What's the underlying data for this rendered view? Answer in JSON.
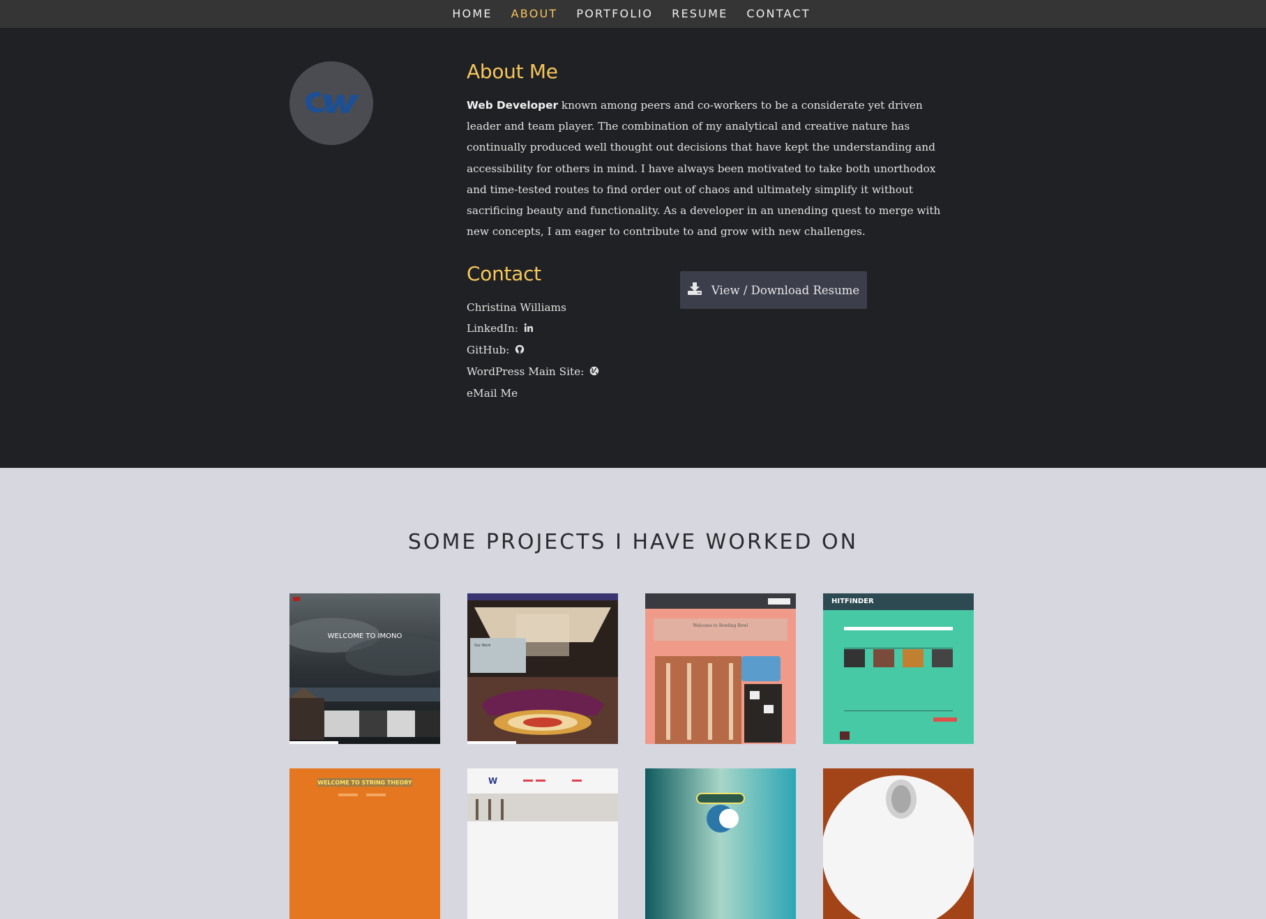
{
  "nav": {
    "items": [
      "HOME",
      "ABOUT",
      "PORTFOLIO",
      "RESUME",
      "CONTACT"
    ],
    "active": "ABOUT"
  },
  "about": {
    "heading": "About Me",
    "role": "Web Developer",
    "bio": " known among peers and co-workers to be a considerate yet driven leader and team player. The combination of my analytical and creative nature has continually produced well thought out decisions that have kept the understanding and accessibility for others in mind. I have always been motivated to take both unorthodox and time-tested routes to find order out of chaos and ultimately simplify it without sacrificing beauty and functionality. As a developer in an unending quest to merge with new concepts, I am eager to contribute to and grow with new challenges.",
    "avatar_text": "CW"
  },
  "contact": {
    "heading": "Contact",
    "name": "Christina Williams",
    "linkedin_label": "LinkedIn:",
    "github_label": "GitHub:",
    "wordpress_label": "WordPress Main Site:",
    "email_label": "eMail Me",
    "resume_button": "View / Download Resume"
  },
  "projects": {
    "title": "SOME PROJECTS I HAVE WORKED ON",
    "thumbs": [
      {
        "id": "imono",
        "caption": "WELCOME TO IMONO"
      },
      {
        "id": "hotel",
        "caption": "Our Work"
      },
      {
        "id": "bowl",
        "caption": "Welcome to Bowling Bowl"
      },
      {
        "id": "hitfinder",
        "caption": "HITFINDER"
      },
      {
        "id": "stringtheory",
        "caption": "WELCOME TO STRING THEORY"
      },
      {
        "id": "phasewave",
        "caption": ""
      },
      {
        "id": "gradient",
        "caption": ""
      },
      {
        "id": "portrait",
        "caption": ""
      }
    ]
  },
  "colors": {
    "accent": "#f6c65c",
    "nav_bg": "#353535",
    "about_bg": "#202124",
    "projects_bg": "#d7d7df",
    "button_bg": "#3c3e4b"
  }
}
